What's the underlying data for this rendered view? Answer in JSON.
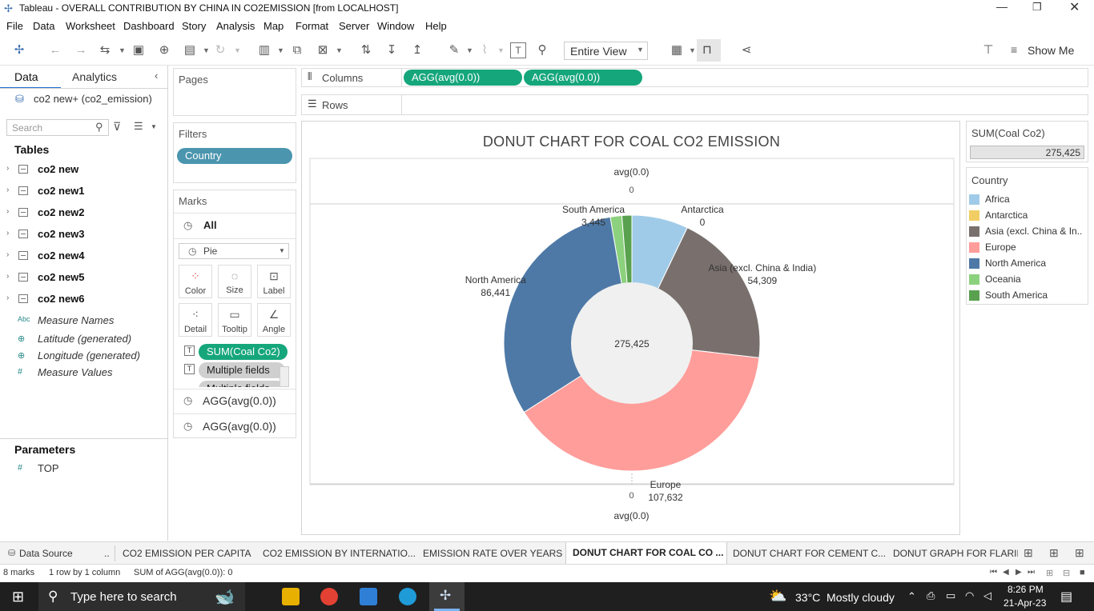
{
  "window": {
    "title": "Tableau - OVERALL CONTRIBUTION BY CHINA IN CO2EMISSION [from LOCALHOST]"
  },
  "menu": [
    "File",
    "Data",
    "Worksheet",
    "Dashboard",
    "Story",
    "Analysis",
    "Map",
    "Format",
    "Server",
    "Window",
    "Help"
  ],
  "toolbar": {
    "view_select": "Entire View",
    "show_me": "Show Me"
  },
  "left_pane": {
    "tab_data": "Data",
    "tab_analytics": "Analytics",
    "datasource": "co2 new+ (co2_emission)",
    "search_placeholder": "Search",
    "tables_header": "Tables",
    "tables": [
      "co2 new",
      "co2 new1",
      "co2 new2",
      "co2 new3",
      "co2 new4",
      "co2 new5",
      "co2 new6"
    ],
    "fields": [
      {
        "icon": "Abc",
        "label": "Measure Names"
      },
      {
        "icon": "globe-icon",
        "label": "Latitude (generated)"
      },
      {
        "icon": "globe-icon",
        "label": "Longitude (generated)"
      },
      {
        "icon": "#",
        "label": "Measure Values"
      }
    ],
    "parameters_header": "Parameters",
    "parameters": [
      {
        "icon": "#",
        "label": "TOP"
      }
    ]
  },
  "cards": {
    "pages": "Pages",
    "filters": "Filters",
    "filter_pill": "Country",
    "marks": "Marks",
    "marks_all": "All",
    "mark_type": "Pie",
    "mark_buttons": [
      "Color",
      "Size",
      "Label",
      "Detail",
      "Tooltip",
      "Angle"
    ],
    "mark_fields": [
      "SUM(Coal Co2)",
      "Multiple fields",
      "Multiple fields"
    ],
    "agg_rows": [
      "AGG(avg(0.0))",
      "AGG(avg(0.0))"
    ]
  },
  "shelves": {
    "columns_label": "Columns",
    "rows_label": "Rows",
    "column_pills": [
      "AGG(avg(0.0))",
      "AGG(avg(0.0))"
    ]
  },
  "viz": {
    "title": "DONUT CHART FOR COAL CO2 EMISSION",
    "axis_top_title": "avg(0.0)",
    "axis_top_tick": "0",
    "axis_bottom_tick": "0",
    "axis_bottom_title": "avg(0.0)",
    "center_total": "275,425"
  },
  "chart_data": {
    "type": "pie",
    "title": "DONUT CHART FOR COAL CO2 EMISSION",
    "donut": true,
    "center_label": "275,425",
    "categories": [
      "Africa",
      "Antarctica",
      "Asia (excl. China & India)",
      "Europe",
      "North America",
      "Oceania",
      "South America"
    ],
    "values": [
      19598,
      0,
      54309,
      107632,
      86441,
      4000,
      3445
    ],
    "labels": {
      "Antarctica": "0",
      "Asia (excl. China & India)": "54,309",
      "Europe": "107,632",
      "North America": "86,441",
      "South America": "3,445"
    },
    "colors": {
      "Africa": "#a0cbe8",
      "Antarctica": "#f1ce63",
      "Asia (excl. China & India)": "#79706e",
      "Europe": "#ff9d9a",
      "North America": "#4e79a7",
      "Oceania": "#8cd17d",
      "South America": "#59a14f"
    }
  },
  "legend": {
    "measure_title": "SUM(Coal Co2)",
    "measure_value": "275,425",
    "country_title": "Country",
    "items": [
      {
        "label": "Africa",
        "color": "#a0cbe8"
      },
      {
        "label": "Antarctica",
        "color": "#f1ce63"
      },
      {
        "label": "Asia (excl. China & In..",
        "color": "#79706e"
      },
      {
        "label": "Europe",
        "color": "#ff9d9a"
      },
      {
        "label": "North America",
        "color": "#4e79a7"
      },
      {
        "label": "Oceania",
        "color": "#8cd17d"
      },
      {
        "label": "South America",
        "color": "#59a14f"
      }
    ]
  },
  "sheet_tabs": [
    "Data Source",
    "..",
    "CO2 EMISSION PER CAPITA",
    "CO2 EMISSION BY INTERNATIO...",
    "EMISSION RATE OVER YEARS",
    "DONUT CHART FOR COAL CO ...",
    "DONUT CHART FOR CEMENT C...",
    "DONUT GRAPH FOR FLARIN"
  ],
  "status": {
    "marks": "8 marks",
    "rows": "1 row by 1 column",
    "sum": "SUM of AGG(avg(0.0)): 0"
  },
  "taskbar": {
    "search": "Type here to search",
    "weather": "33°C  Mostly cloudy",
    "time": "8:26 PM",
    "date": "21-Apr-23"
  }
}
